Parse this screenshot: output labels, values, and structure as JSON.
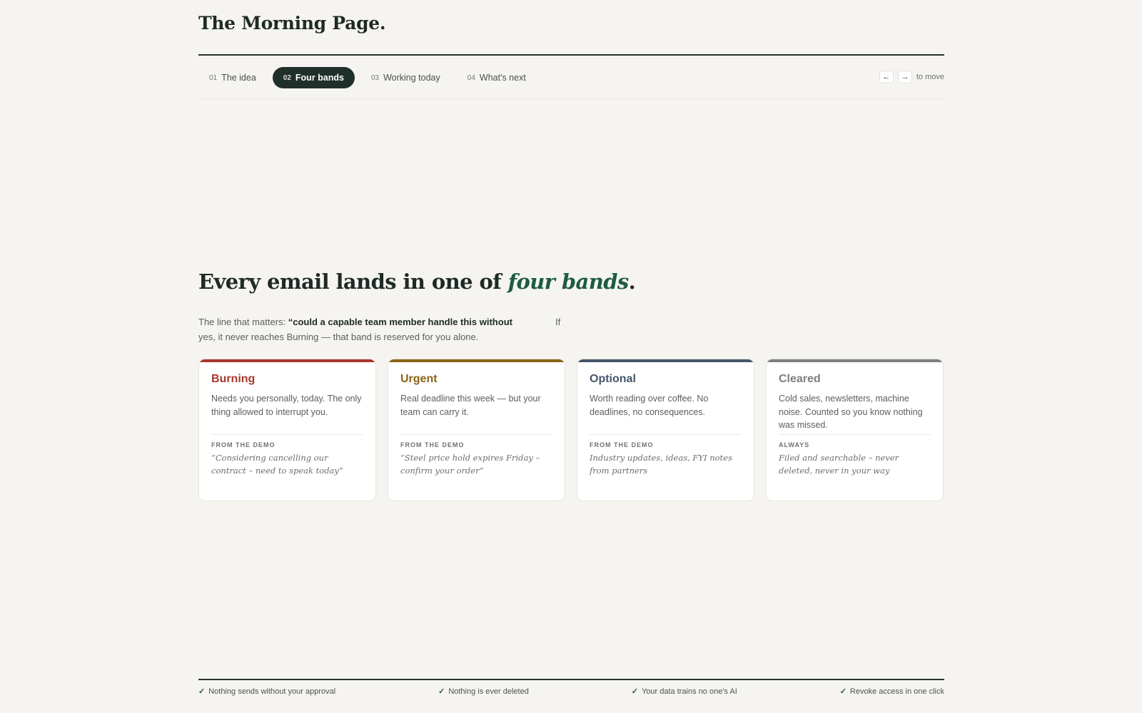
{
  "brand": "The Morning Page.",
  "tabs": [
    {
      "num": "01",
      "label": "The idea",
      "active": false
    },
    {
      "num": "02",
      "label": "Four bands",
      "active": true
    },
    {
      "num": "03",
      "label": "Working today",
      "active": false
    },
    {
      "num": "04",
      "label": "What's next",
      "active": false
    }
  ],
  "nav": {
    "prev_key": "←",
    "next_key": "→",
    "hint": "to move"
  },
  "hero": {
    "headline_start": "Every email lands in one of ",
    "headline_em": "four bands",
    "headline_end": ".",
    "lead_start": "The line that matters: ",
    "lead_bold": "“could a capable team member handle this without",
    "lead_if": "If",
    "lead_end": "yes, it never reaches Burning — that band is reserved for you alone."
  },
  "cards": [
    {
      "title": "Burning",
      "color": "#a8372c",
      "desc": "Needs you personally, today. The only thing allowed to interrupt you.",
      "caption": "FROM THE DEMO",
      "quote": "“Considering cancelling our contract – need to speak today”"
    },
    {
      "title": "Urgent",
      "color": "#8a6419",
      "desc": "Real deadline this week — but your team can carry it.",
      "caption": "FROM THE DEMO",
      "quote": "“Steel price hold expires Friday – confirm your order”"
    },
    {
      "title": "Optional",
      "color": "#46566b",
      "desc": "Worth reading over coffee. No deadlines, no consequences.",
      "caption": "FROM THE DEMO",
      "quote": "Industry updates, ideas, FYI notes from partners"
    },
    {
      "title": "Cleared",
      "color": "#7c7f7b",
      "desc": "Cold sales, newsletters, machine noise. Counted so you know nothing was missed.",
      "caption": "ALWAYS",
      "quote": "Filed and searchable – never deleted, never in your way"
    }
  ],
  "footer": [
    {
      "check": "✓",
      "text": "Nothing sends without your approval"
    },
    {
      "check": "✓",
      "text": "Nothing is ever deleted"
    },
    {
      "check": "✓",
      "text": "Your data trains no one's AI"
    },
    {
      "check": "✓",
      "text": "Revoke access in one click"
    }
  ]
}
